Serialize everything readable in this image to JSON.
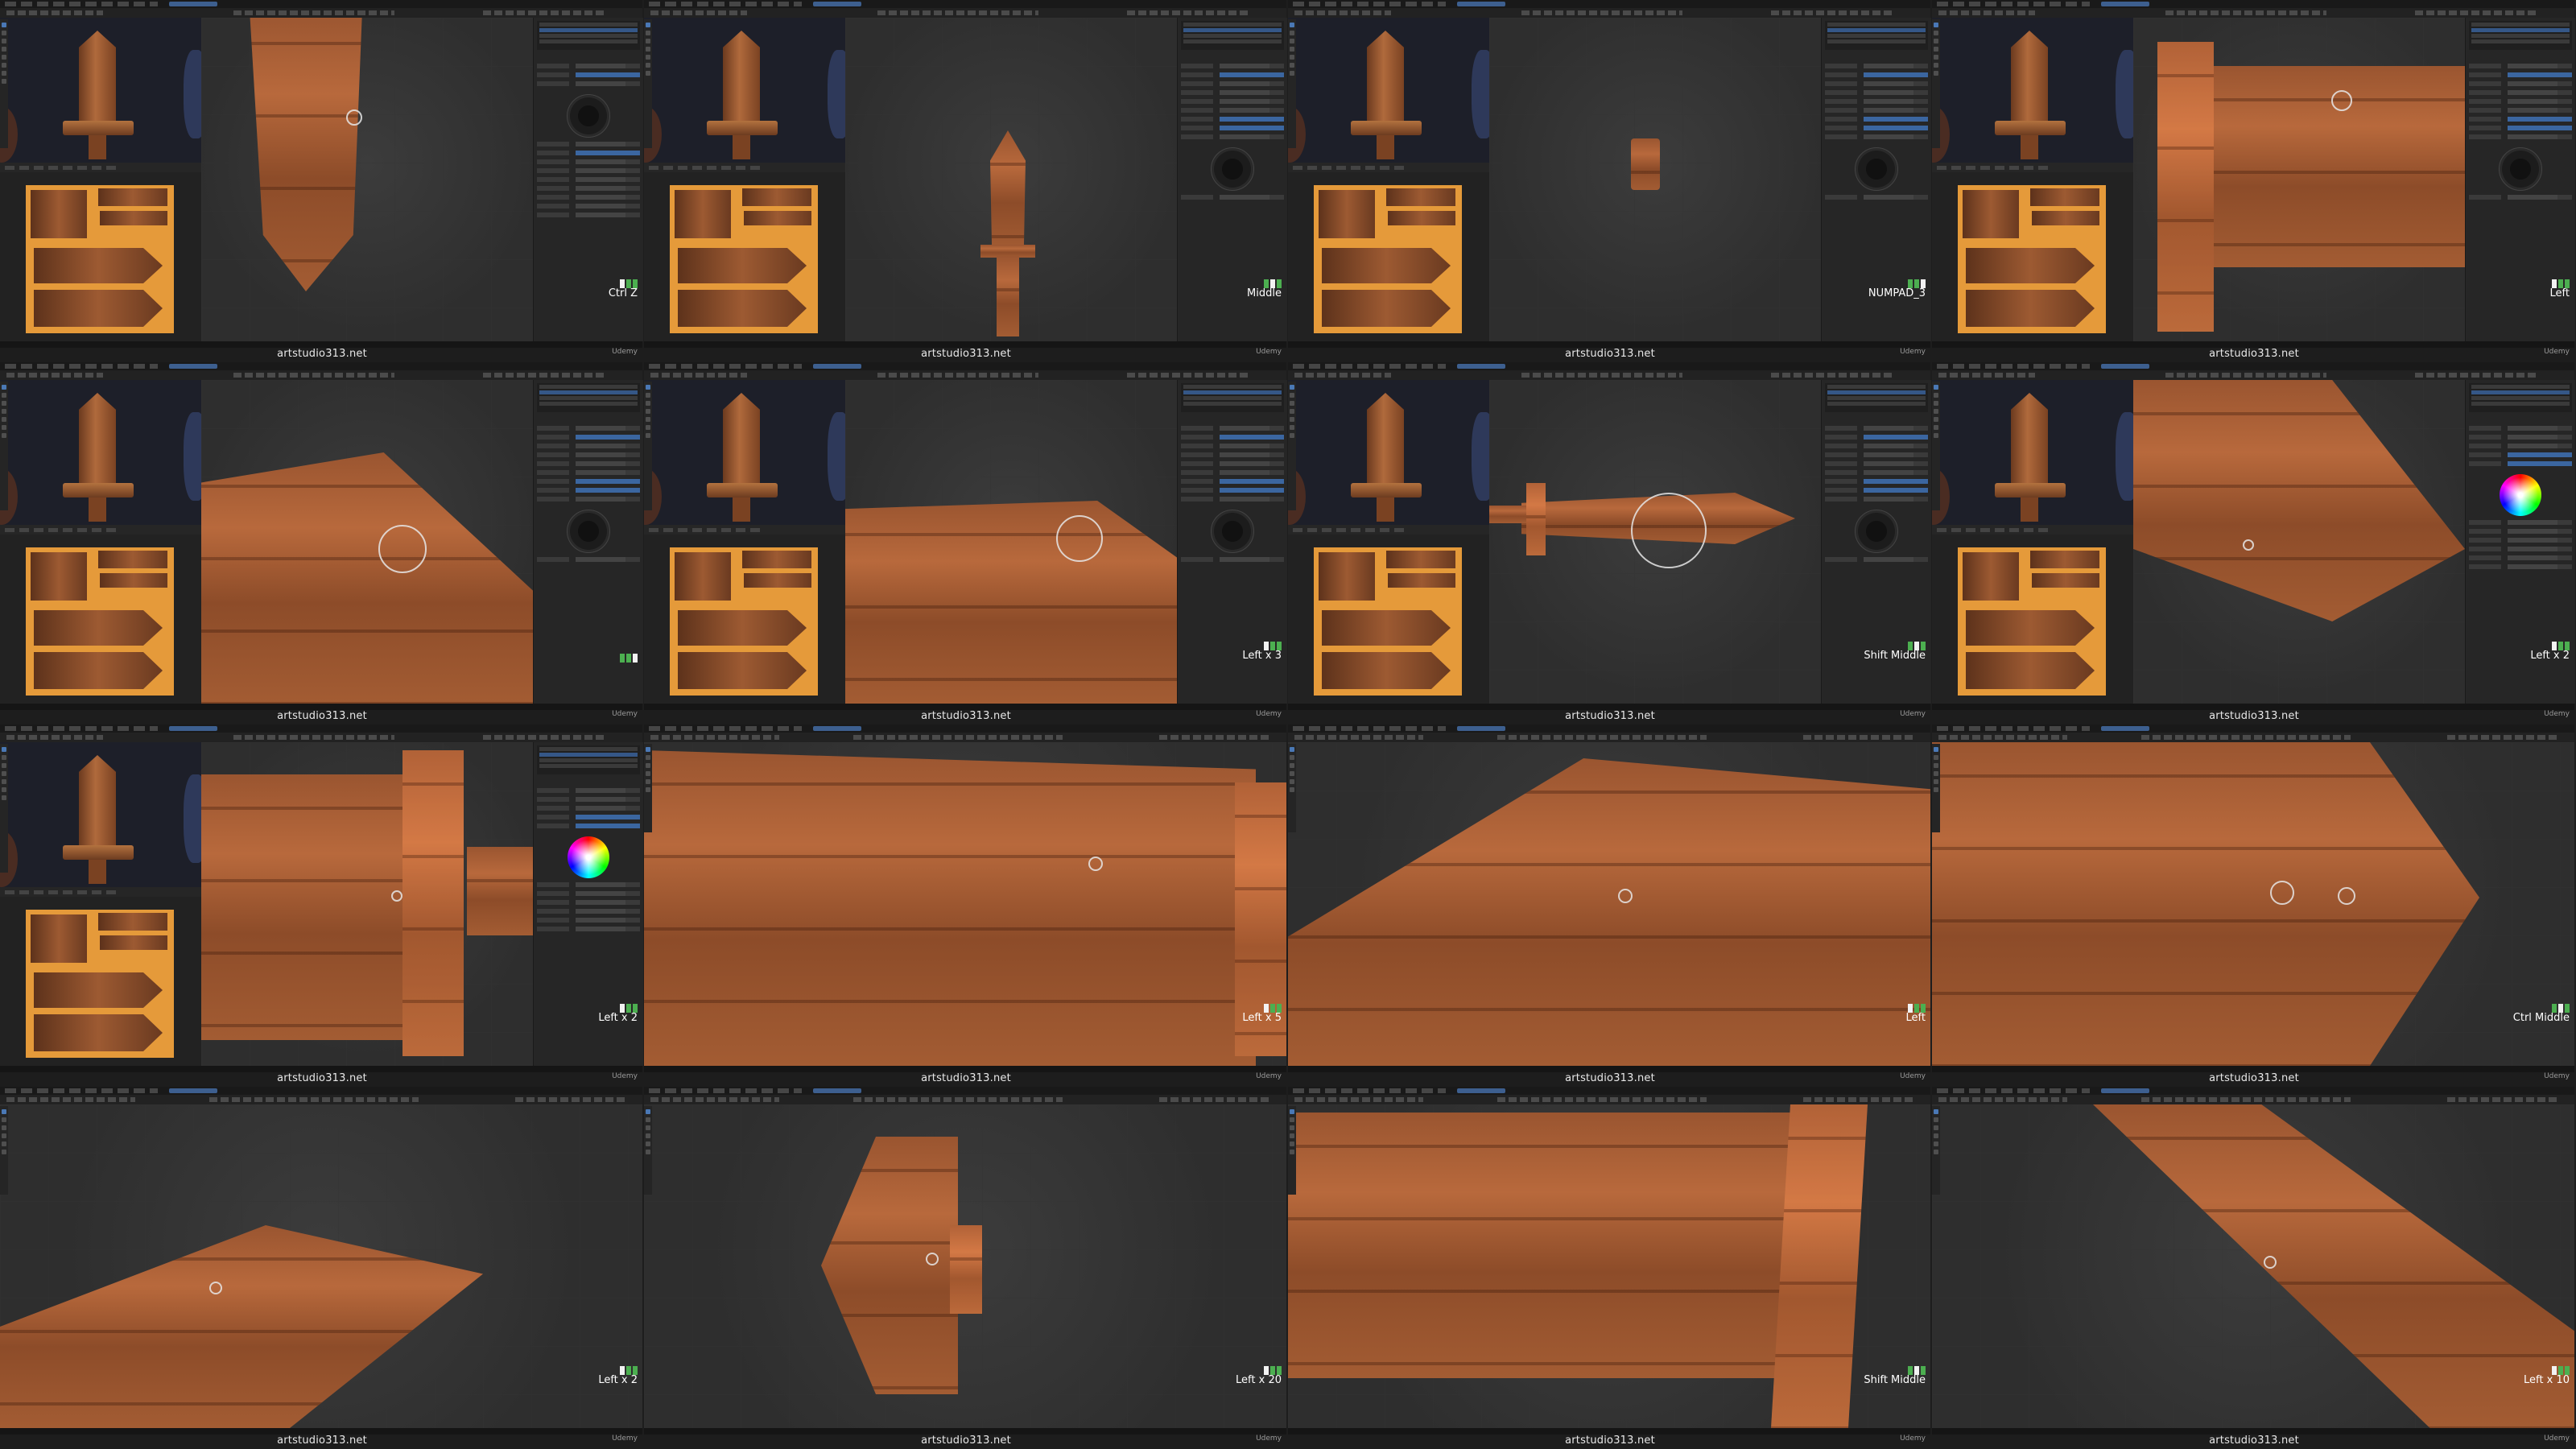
{
  "watermark": "artstudio313.net",
  "platform": "Udemy",
  "colors": {
    "wood_dark": "#6b3a1f",
    "wood_mid": "#a35c33",
    "wood_light": "#c5804a",
    "texture_bg": "#e59a3a",
    "viewport_bg": "#2e2e2e",
    "ui_dark": "#1d1d1d",
    "selection_blue": "#3b66a0",
    "key_green": "#4caf50",
    "key_white": "#f2f2f2"
  },
  "tiles": [
    {
      "id": 1,
      "key_label": "Ctrl Z",
      "layout": "full",
      "mouse": [
        "white",
        "green",
        "green"
      ],
      "wheel": "dark"
    },
    {
      "id": 2,
      "key_label": "Middle",
      "layout": "full",
      "mouse": [
        "green",
        "white",
        "green"
      ],
      "wheel": "dark"
    },
    {
      "id": 3,
      "key_label": "NUMPAD_3",
      "layout": "full",
      "mouse": [
        "green",
        "green",
        "white"
      ],
      "wheel": "dark"
    },
    {
      "id": 4,
      "key_label": "Left",
      "layout": "full",
      "mouse": [
        "white",
        "green",
        "green"
      ],
      "wheel": "dark"
    },
    {
      "id": 5,
      "key_label": "",
      "layout": "full",
      "mouse": [
        "green",
        "green",
        "white"
      ],
      "wheel": "dark"
    },
    {
      "id": 6,
      "key_label": "Left x 3",
      "layout": "full",
      "mouse": [
        "white",
        "green",
        "green"
      ],
      "wheel": "dark"
    },
    {
      "id": 7,
      "key_label": "Shift Middle",
      "layout": "full",
      "mouse": [
        "green",
        "white",
        "green"
      ],
      "wheel": "dark"
    },
    {
      "id": 8,
      "key_label": "Left x 2",
      "layout": "full",
      "mouse": [
        "white",
        "green",
        "green"
      ],
      "wheel": "rainbow"
    },
    {
      "id": 9,
      "key_label": "Left x 2",
      "layout": "full",
      "mouse": [
        "white",
        "green",
        "green"
      ],
      "wheel": "rainbow"
    },
    {
      "id": 10,
      "key_label": "Left x 5",
      "layout": "viewport",
      "mouse": [
        "white",
        "green",
        "green"
      ]
    },
    {
      "id": 11,
      "key_label": "Left",
      "layout": "viewport",
      "mouse": [
        "white",
        "green",
        "green"
      ]
    },
    {
      "id": 12,
      "key_label": "Ctrl Middle",
      "layout": "viewport",
      "mouse": [
        "green",
        "white",
        "green"
      ]
    },
    {
      "id": 13,
      "key_label": "Left x 2",
      "layout": "viewport",
      "mouse": [
        "white",
        "green",
        "green"
      ]
    },
    {
      "id": 14,
      "key_label": "Left x 20",
      "layout": "viewport",
      "mouse": [
        "white",
        "green",
        "green"
      ]
    },
    {
      "id": 15,
      "key_label": "Shift Middle",
      "layout": "viewport",
      "mouse": [
        "green",
        "white",
        "green"
      ]
    },
    {
      "id": 16,
      "key_label": "Left x 10",
      "layout": "viewport",
      "mouse": [
        "white",
        "green",
        "green"
      ]
    }
  ]
}
